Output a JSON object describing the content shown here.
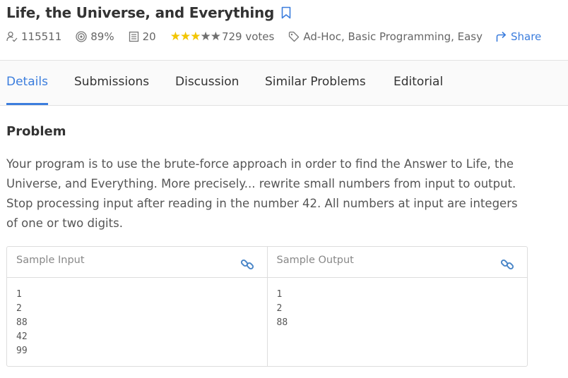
{
  "problem": {
    "title": "Life, the Universe, and Everything",
    "solved_count": "115511",
    "accuracy": "89%",
    "points": "20",
    "rating": {
      "filled": 3,
      "total": 5
    },
    "votes_text": "729 votes",
    "tags_text": "Ad-Hoc, Basic Programming, Easy",
    "share_label": "Share"
  },
  "tabs": [
    {
      "label": "Details",
      "active": true
    },
    {
      "label": "Submissions",
      "active": false
    },
    {
      "label": "Discussion",
      "active": false
    },
    {
      "label": "Similar Problems",
      "active": false
    },
    {
      "label": "Editorial",
      "active": false
    }
  ],
  "section": {
    "heading": "Problem",
    "statement_lines": [
      "Your program is to use the brute-force approach in order to find the Answer to Life, the",
      "Universe, and Everything. More precisely... rewrite small numbers from input to output.",
      "Stop processing input after reading in the number 42. All numbers at input are integers",
      "of one or two digits."
    ]
  },
  "samples": {
    "input_label": "Sample Input",
    "output_label": "Sample Output",
    "input_lines": [
      "1",
      "2",
      "88",
      "42",
      "99"
    ],
    "output_lines": [
      "1",
      "2",
      "88"
    ]
  },
  "colors": {
    "accent": "#3b7ddd",
    "star_filled": "#f2c500",
    "star_empty": "#6f6f6f"
  },
  "icons": {
    "solved": "user-check-icon",
    "accuracy": "target-icon",
    "points": "document-icon",
    "tag": "tag-icon",
    "share": "share-arrow-icon",
    "bookmark": "bookmark-icon",
    "link": "link-icon"
  }
}
